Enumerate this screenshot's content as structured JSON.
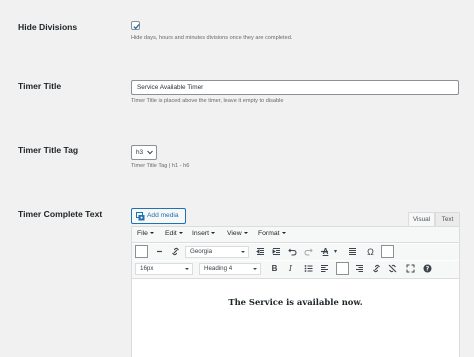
{
  "hide_divisions": {
    "label": "Hide Divisions",
    "checked": true,
    "description": "Hide days, hours and minutes divisions once they are completed."
  },
  "timer_title": {
    "label": "Timer Title",
    "value": "Service Available Timer",
    "description": "Timer Title is placed above the timer, leave it empty to disable"
  },
  "timer_title_tag": {
    "label": "Timer Title Tag",
    "selected": "h3",
    "description": "Timer Title Tag | h1 - h6"
  },
  "timer_complete_text": {
    "label": "Timer Complete Text",
    "add_media": "Add media",
    "tabs": {
      "visual": "Visual",
      "text": "Text"
    },
    "menu": [
      "File",
      "Edit",
      "Insert",
      "View",
      "Format"
    ],
    "font_family": "Georgia",
    "font_size": "16px",
    "block_format": "Heading 4",
    "content": "The Service is available now."
  },
  "colors": {
    "accent": "#2271b1",
    "label_text": "#1d2327",
    "muted_text": "#646970",
    "background": "#f1f1f1"
  }
}
